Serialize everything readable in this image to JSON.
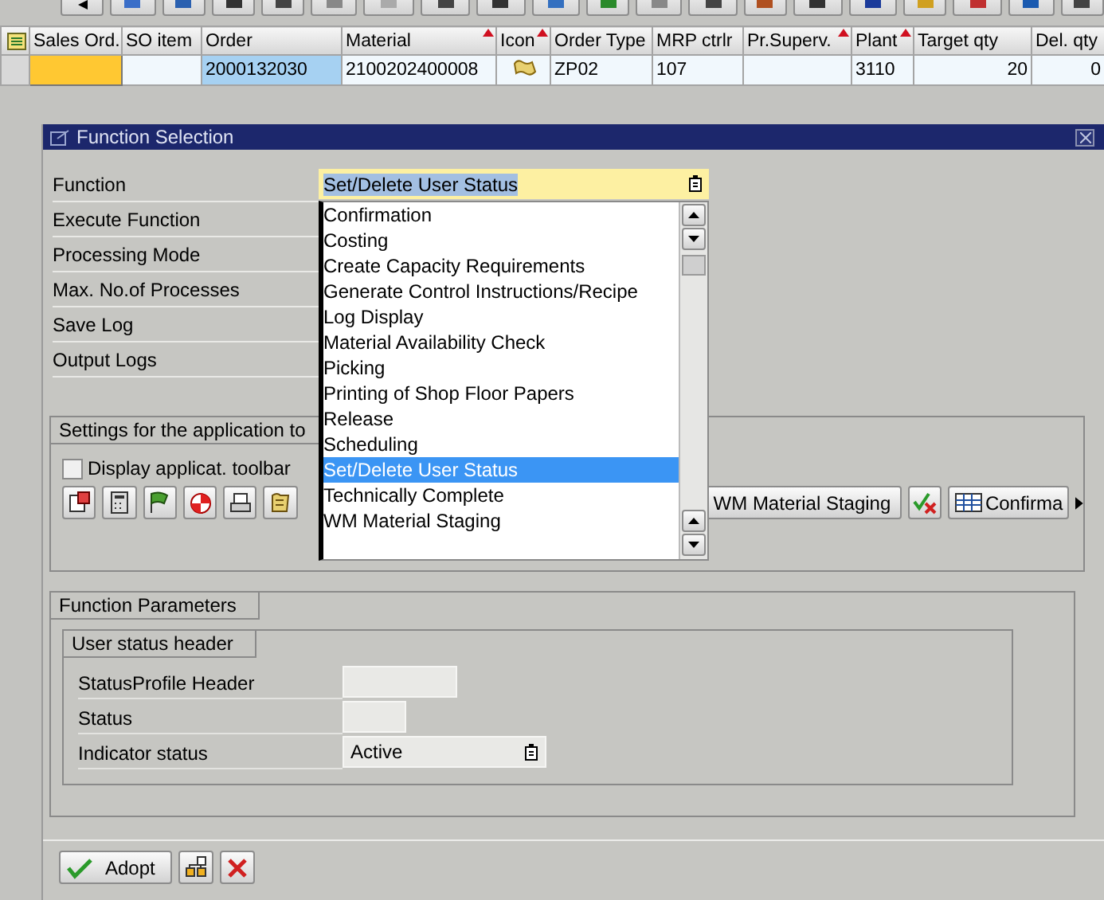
{
  "grid": {
    "columns": [
      {
        "label": "Sales Ord.",
        "sorted": false
      },
      {
        "label": "SO item",
        "sorted": false
      },
      {
        "label": "Order",
        "sorted": false
      },
      {
        "label": "Material",
        "sorted": true
      },
      {
        "label": "Icon",
        "sorted": true
      },
      {
        "label": "Order Type",
        "sorted": false
      },
      {
        "label": "MRP ctrlr",
        "sorted": false
      },
      {
        "label": "Pr.Superv.",
        "sorted": true
      },
      {
        "label": "Plant",
        "sorted": true
      },
      {
        "label": "Target qty",
        "sorted": false
      },
      {
        "label": "Del. qty",
        "sorted": false
      }
    ],
    "rows": [
      {
        "cells": [
          {
            "kind": "input"
          },
          {
            "kind": "text"
          },
          {
            "kind": "selected",
            "text": "2000132030"
          },
          {
            "kind": "text",
            "text": "2100202400008"
          },
          {
            "kind": "icon"
          },
          {
            "kind": "text",
            "text": "ZP02"
          },
          {
            "kind": "text",
            "text": "107"
          },
          {
            "kind": "text"
          },
          {
            "kind": "text",
            "text": "3110"
          },
          {
            "kind": "number",
            "text": "20"
          },
          {
            "kind": "number",
            "text": "0"
          }
        ]
      }
    ]
  },
  "dialog": {
    "title": "Function Selection",
    "labels": [
      "Function",
      "Execute Function",
      "Processing Mode",
      "Max. No.of Processes",
      "Save Log",
      "Output Logs"
    ],
    "function_field": {
      "value": "Set/Delete User Status"
    },
    "dropdown": {
      "items": [
        {
          "label": "Confirmation",
          "selected": false
        },
        {
          "label": "Costing",
          "selected": false
        },
        {
          "label": "Create Capacity Requirements",
          "selected": false
        },
        {
          "label": "Generate Control Instructions/Recipe",
          "selected": false
        },
        {
          "label": "Log Display",
          "selected": false
        },
        {
          "label": "Material Availability Check",
          "selected": false
        },
        {
          "label": "Picking",
          "selected": false
        },
        {
          "label": "Printing of Shop Floor Papers",
          "selected": false
        },
        {
          "label": "Release",
          "selected": false
        },
        {
          "label": "Scheduling",
          "selected": false
        },
        {
          "label": "Set/Delete User Status",
          "selected": true
        },
        {
          "label": "Technically Complete",
          "selected": false
        },
        {
          "label": "WM Material Staging",
          "selected": false
        }
      ]
    },
    "settings": {
      "title": "Settings for the application to",
      "checkbox": {
        "label": "Display applicat. toolbar",
        "checked": false
      },
      "buttons": [
        {
          "label": "WM Material Staging",
          "kind": "text"
        },
        {
          "kind": "icon"
        },
        {
          "label": "Confirma",
          "kind": "text-icon"
        }
      ]
    },
    "parameters": {
      "title": "Function Parameters",
      "group": {
        "title": "User status header",
        "fields": [
          {
            "label": "StatusProfile Header",
            "kind": "input"
          },
          {
            "label": "Status",
            "kind": "input"
          },
          {
            "label": "Indicator status",
            "kind": "select",
            "value": "Active"
          }
        ]
      }
    },
    "footer": {
      "adopt": "Adopt"
    }
  }
}
